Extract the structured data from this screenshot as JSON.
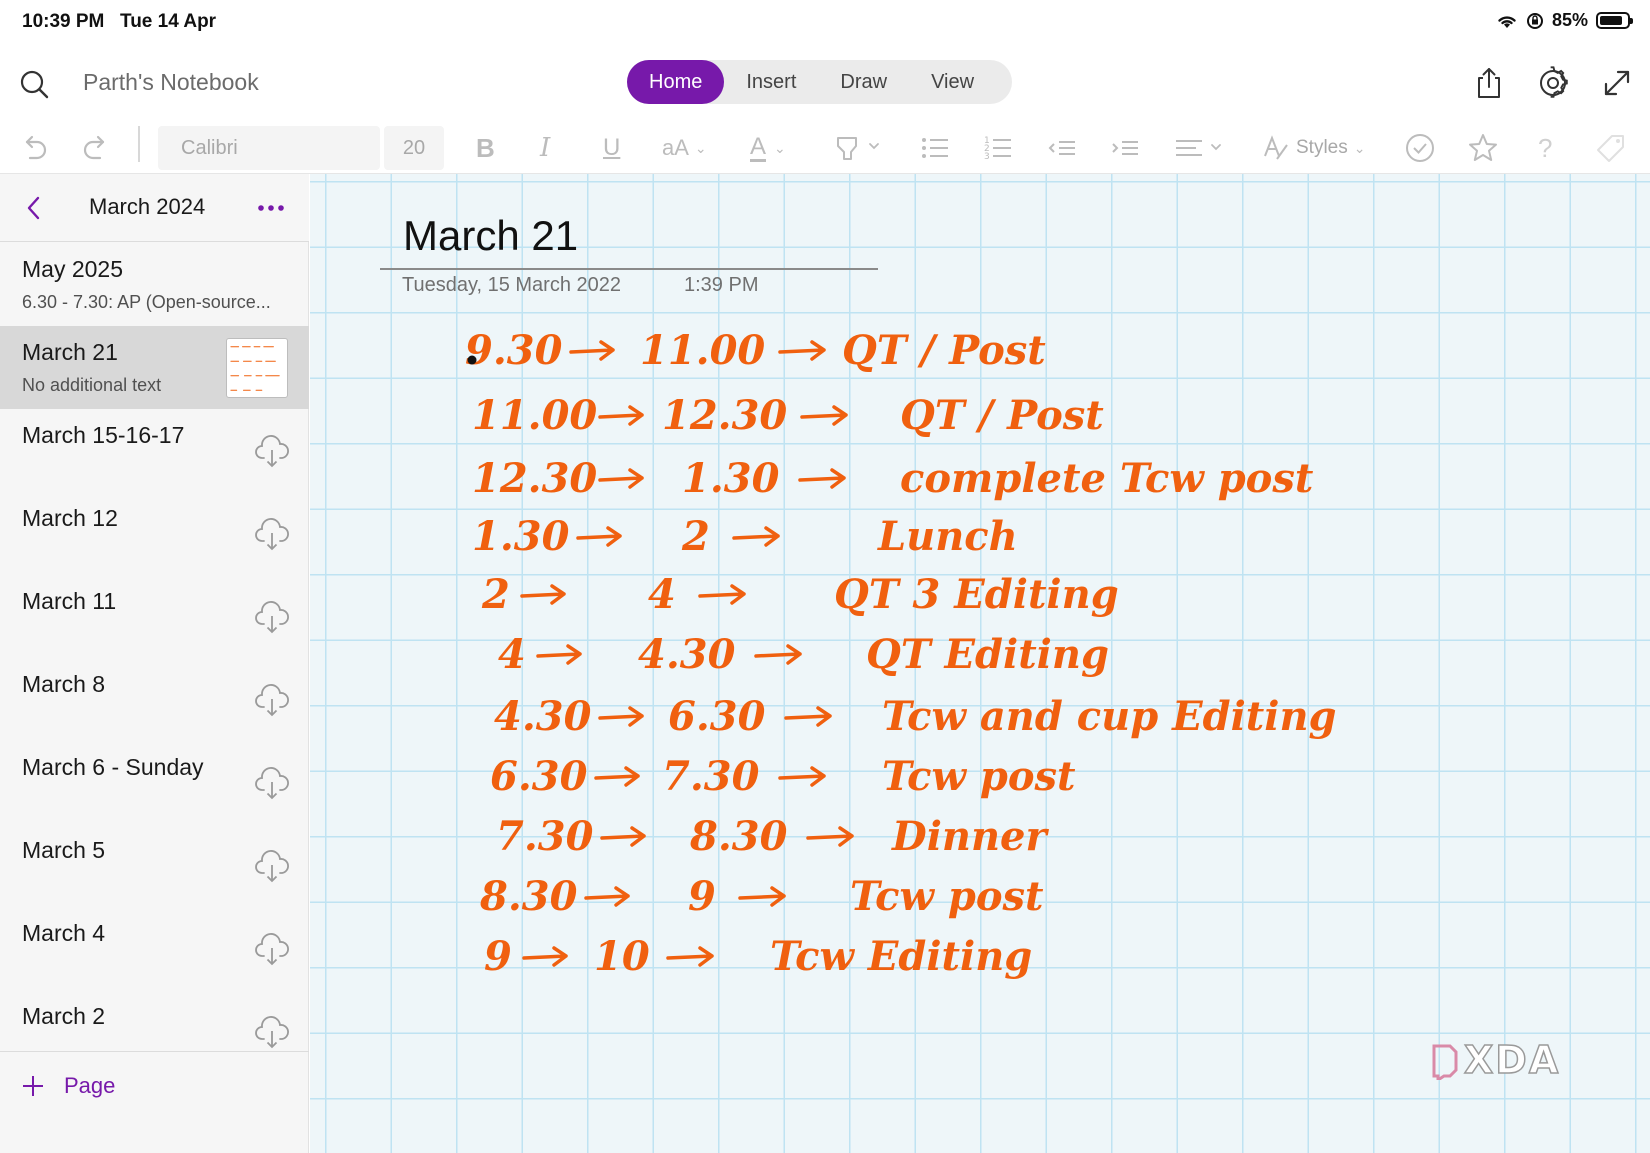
{
  "status_bar": {
    "time": "10:39 PM",
    "date": "Tue 14 Apr",
    "battery": "85%"
  },
  "topbar": {
    "notebook_title": "Parth's Notebook",
    "tabs": [
      {
        "label": "Home",
        "active": true
      },
      {
        "label": "Insert",
        "active": false
      },
      {
        "label": "Draw",
        "active": false
      },
      {
        "label": "View",
        "active": false
      }
    ],
    "accent": "#7719aa"
  },
  "ribbon": {
    "font": "Calibri",
    "size": "20",
    "styles_label": "Styles"
  },
  "sidebar": {
    "section_title": "March 2024",
    "pages": [
      {
        "title": "May 2025",
        "subtitle": "6.30 - 7.30: AP (Open-source...",
        "selected": false,
        "cloud": false
      },
      {
        "title": "March 21",
        "subtitle": "No additional text",
        "selected": true,
        "cloud": false
      },
      {
        "title": "March 15-16-17",
        "subtitle": "",
        "selected": false,
        "cloud": true
      },
      {
        "title": "March 12",
        "subtitle": "",
        "selected": false,
        "cloud": true
      },
      {
        "title": "March 11",
        "subtitle": "",
        "selected": false,
        "cloud": true
      },
      {
        "title": "March 8",
        "subtitle": "",
        "selected": false,
        "cloud": true
      },
      {
        "title": "March 6 - Sunday",
        "subtitle": "",
        "selected": false,
        "cloud": true
      },
      {
        "title": "March 5",
        "subtitle": "",
        "selected": false,
        "cloud": true
      },
      {
        "title": "March 4",
        "subtitle": "",
        "selected": false,
        "cloud": true
      },
      {
        "title": "March 2",
        "subtitle": "",
        "selected": false,
        "cloud": true
      }
    ],
    "add_page_label": "Page"
  },
  "page": {
    "title": "March 21",
    "date": "Tuesday, 15 March 2022",
    "time": "1:39 PM",
    "ink_color": "#f0600f",
    "handwritten_lines": [
      {
        "start": "9.30",
        "end": "11.00",
        "task": "QT / Post"
      },
      {
        "start": "11.00",
        "end": "12.30",
        "task": "QT / Post"
      },
      {
        "start": "12.30",
        "end": "1.30",
        "task": "complete Tcw post"
      },
      {
        "start": "1.30",
        "end": "2",
        "task": "Lunch"
      },
      {
        "start": "2",
        "end": "4",
        "task": "QT 3 Editing"
      },
      {
        "start": "4",
        "end": "4.30",
        "task": "QT Editing"
      },
      {
        "start": "4.30",
        "end": "6.30",
        "task": "Tcw and cup Editing"
      },
      {
        "start": "6.30",
        "end": "7.30",
        "task": "Tcw post"
      },
      {
        "start": "7.30",
        "end": "8.30",
        "task": "Dinner"
      },
      {
        "start": "8.30",
        "end": "9",
        "task": "Tcw post"
      },
      {
        "start": "9",
        "end": "10",
        "task": "Tcw Editing"
      }
    ]
  },
  "watermark": "XDA"
}
